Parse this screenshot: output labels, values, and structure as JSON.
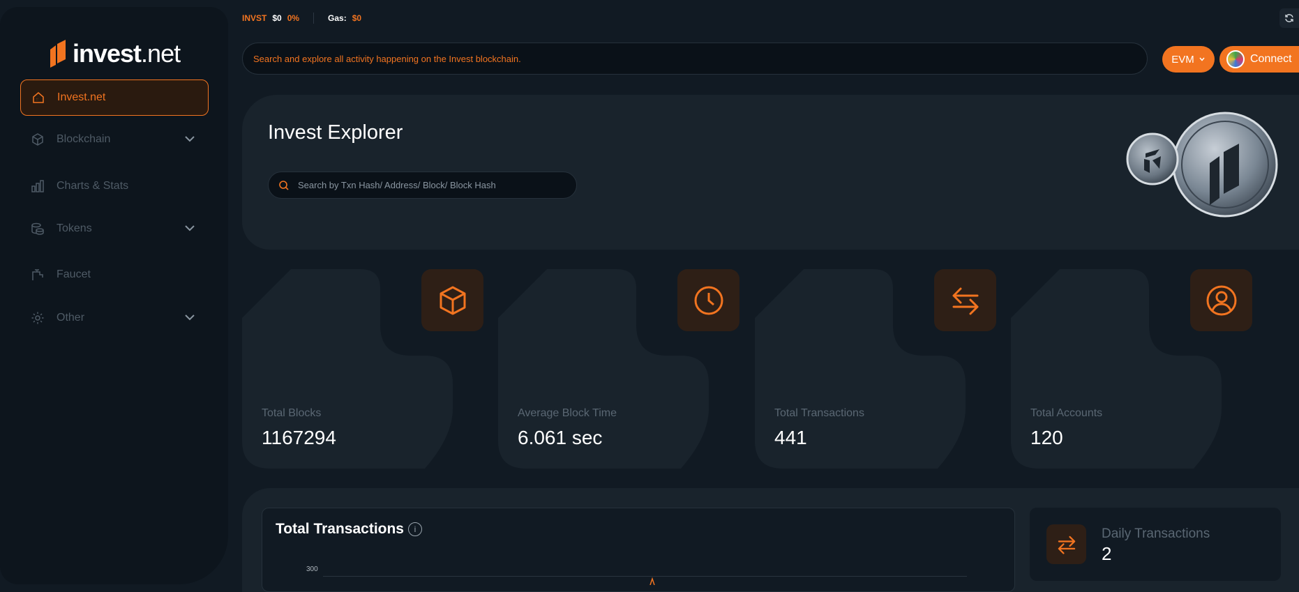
{
  "brand": {
    "name": "invest",
    "tld": ".net"
  },
  "sidebar": {
    "items": [
      {
        "label": "Invest.net",
        "active": true,
        "icon": "home-icon",
        "has_submenu": false
      },
      {
        "label": "Blockchain",
        "active": false,
        "icon": "cube-icon",
        "has_submenu": true
      },
      {
        "label": "Charts & Stats",
        "active": false,
        "icon": "bar-chart-icon",
        "has_submenu": false
      },
      {
        "label": "Tokens",
        "active": false,
        "icon": "coins-icon",
        "has_submenu": true
      },
      {
        "label": "Faucet",
        "active": false,
        "icon": "faucet-icon",
        "has_submenu": false
      },
      {
        "label": "Other",
        "active": false,
        "icon": "gear-icon",
        "has_submenu": true
      }
    ]
  },
  "ticker": {
    "symbol": "INVST",
    "price": "$0",
    "change": "0%",
    "gas_label": "Gas:",
    "gas_value": "$0"
  },
  "header": {
    "search_text": "Search and explore all activity happening on the Invest blockchain.",
    "network_label": "EVM",
    "connect_label": "Connect"
  },
  "hero": {
    "title": "Invest Explorer",
    "search_placeholder": "Search by Txn Hash/ Address/ Block/ Block Hash"
  },
  "stats": [
    {
      "label": "Total Blocks",
      "value": "1167294",
      "icon": "cube-icon"
    },
    {
      "label": "Average Block Time",
      "value": "6.061 sec",
      "icon": "clock-icon"
    },
    {
      "label": "Total Transactions",
      "value": "441",
      "icon": "transfer-arrows-icon"
    },
    {
      "label": "Total Accounts",
      "value": "120",
      "icon": "user-icon"
    }
  ],
  "chart_section": {
    "title": "Total Transactions",
    "y_tick_top": "300"
  },
  "daily": {
    "label": "Daily Transactions",
    "value": "2"
  },
  "colors": {
    "accent": "#f27420",
    "background": "#111a23",
    "panel": "#19232c",
    "sidebar": "#0d151d"
  }
}
